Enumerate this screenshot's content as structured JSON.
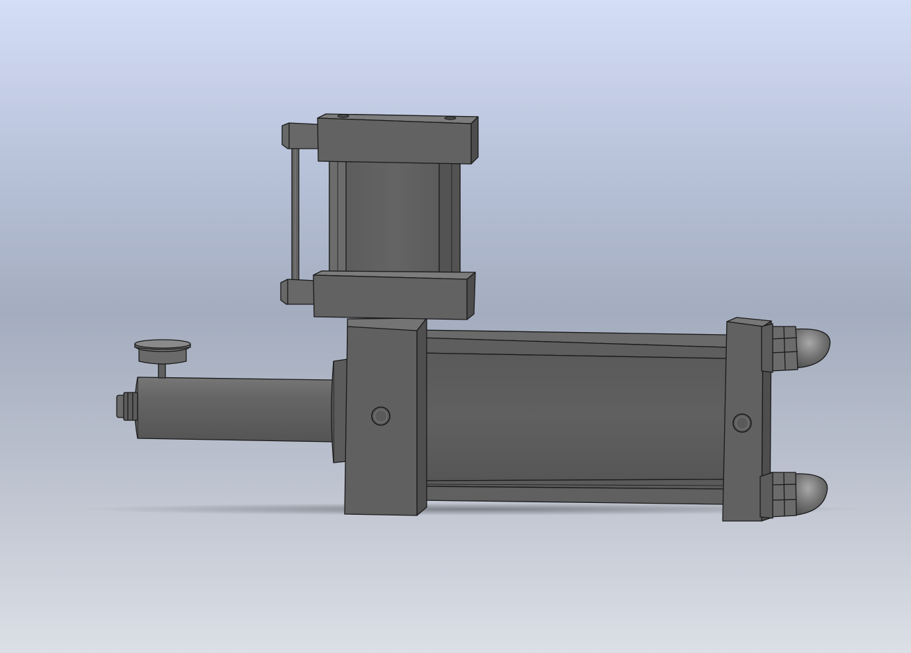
{
  "scene": {
    "background_top": "#d5def7",
    "background_bottom": "#dcdfe6",
    "body_color": "#5f5f5f",
    "edge_color": "#1a1a1a",
    "highlight_color": "#8a8a8a"
  },
  "parts": [
    {
      "name": "pilot-cylinder-top-cap"
    },
    {
      "name": "pilot-cylinder-body"
    },
    {
      "name": "pilot-cylinder-bottom-cap"
    },
    {
      "name": "pilot-tie-rod"
    },
    {
      "name": "mounting-block"
    },
    {
      "name": "main-cylinder-barrel"
    },
    {
      "name": "main-cylinder-end-cap"
    },
    {
      "name": "tie-rod-nut-top"
    },
    {
      "name": "tie-rod-nut-bottom"
    },
    {
      "name": "plunger-tube"
    },
    {
      "name": "adjust-knob"
    },
    {
      "name": "port-fitting"
    }
  ]
}
